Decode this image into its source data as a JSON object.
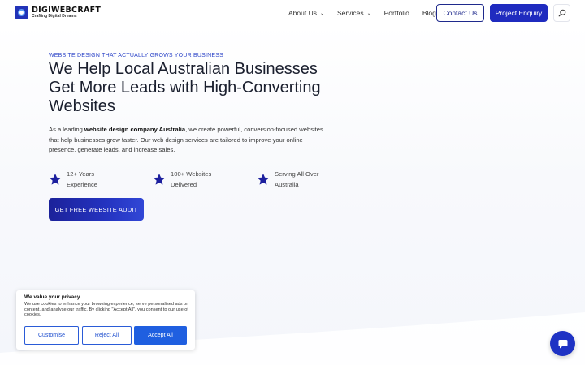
{
  "brand": {
    "name": "DIGIWEBCRAFT",
    "tagline": "Crafting Digital Dreams"
  },
  "nav": {
    "items": [
      {
        "label": "About Us",
        "has_dropdown": true
      },
      {
        "label": "Services",
        "has_dropdown": true
      },
      {
        "label": "Portfolio",
        "has_dropdown": false
      },
      {
        "label": "Blog",
        "has_dropdown": false
      }
    ],
    "contact_label": "Contact Us",
    "enquiry_label": "Project Enquiry",
    "search_icon": "search-icon"
  },
  "hero": {
    "eyebrow": "WEBSITE DESIGN THAT ACTUALLY GROWS YOUR BUSINESS",
    "headline": "We Help Local Australian Businesses Get More Leads with High-Converting Websites",
    "intro_prefix": "As a leading ",
    "intro_bold": "website design company Australia",
    "intro_suffix": ", we create powerful, conversion-focused websites that help businesses grow faster. Our web design services are tailored to improve your online presence, generate leads, and increase sales.",
    "stats": [
      {
        "icon": "star-icon",
        "text": "12+ Years Experience"
      },
      {
        "icon": "star-icon",
        "text": "100+ Websites Delivered"
      },
      {
        "icon": "star-icon",
        "text": "Serving All Over Australia"
      }
    ],
    "cta_label": "GET FREE WEBSITE AUDIT"
  },
  "cookie_banner": {
    "title": "We value your privacy",
    "body": "We use cookies to enhance your browsing experience, serve personalised ads or content, and analyse our traffic. By clicking \"Accept All\", you consent to our use of cookies.",
    "customise_label": "Customise",
    "reject_label": "Reject All",
    "accept_label": "Accept All"
  },
  "chat": {
    "icon": "chat-bubble-icon"
  },
  "colors": {
    "brand_blue": "#1f2bbf",
    "accent_blue": "#2f47c8",
    "star_navy": "#1c1f9e",
    "cookie_blue": "#1f5fe0"
  }
}
